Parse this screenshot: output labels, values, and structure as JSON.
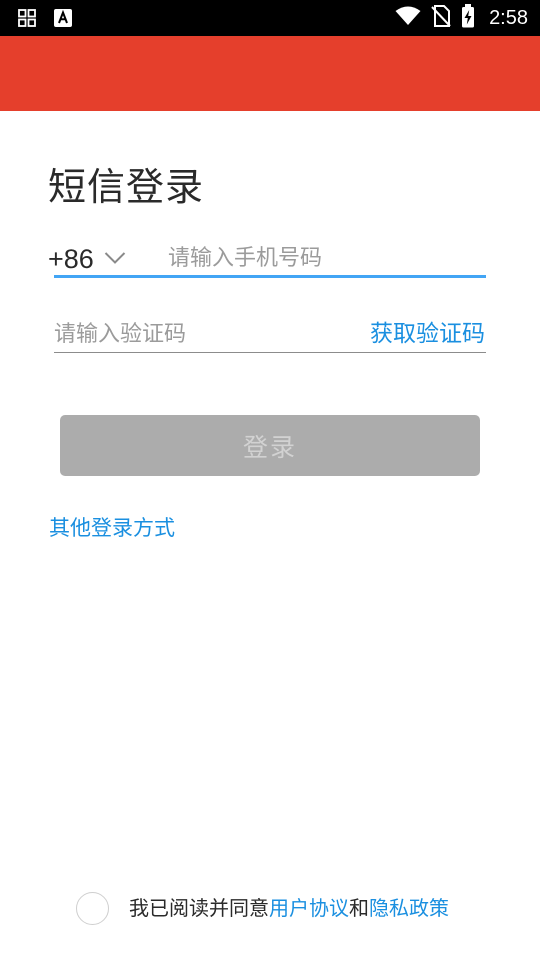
{
  "status_bar": {
    "time": "2:58",
    "left_icons": [
      "grid-icon",
      "font-a-icon"
    ],
    "right_icons": [
      "wifi-icon",
      "no-sim-icon",
      "battery-charging-icon"
    ]
  },
  "app_bar": {
    "color": "#e53f2c"
  },
  "page": {
    "title": "短信登录"
  },
  "phone": {
    "country_code": "+86",
    "placeholder": "请输入手机号码",
    "value": ""
  },
  "code": {
    "placeholder": "请输入验证码",
    "value": "",
    "get_code_label": "获取验证码"
  },
  "login_button": {
    "label": "登录",
    "state": "disabled"
  },
  "other_login": {
    "label": "其他登录方式"
  },
  "agreement": {
    "checked": false,
    "prefix": "我已阅读并同意",
    "user_agreement": "用户协议",
    "conjunction": "和",
    "privacy_policy": "隐私政策"
  },
  "colors": {
    "accent": "#1a8fe0",
    "active_underline": "#42a5f5",
    "button_disabled": "#acacac"
  }
}
